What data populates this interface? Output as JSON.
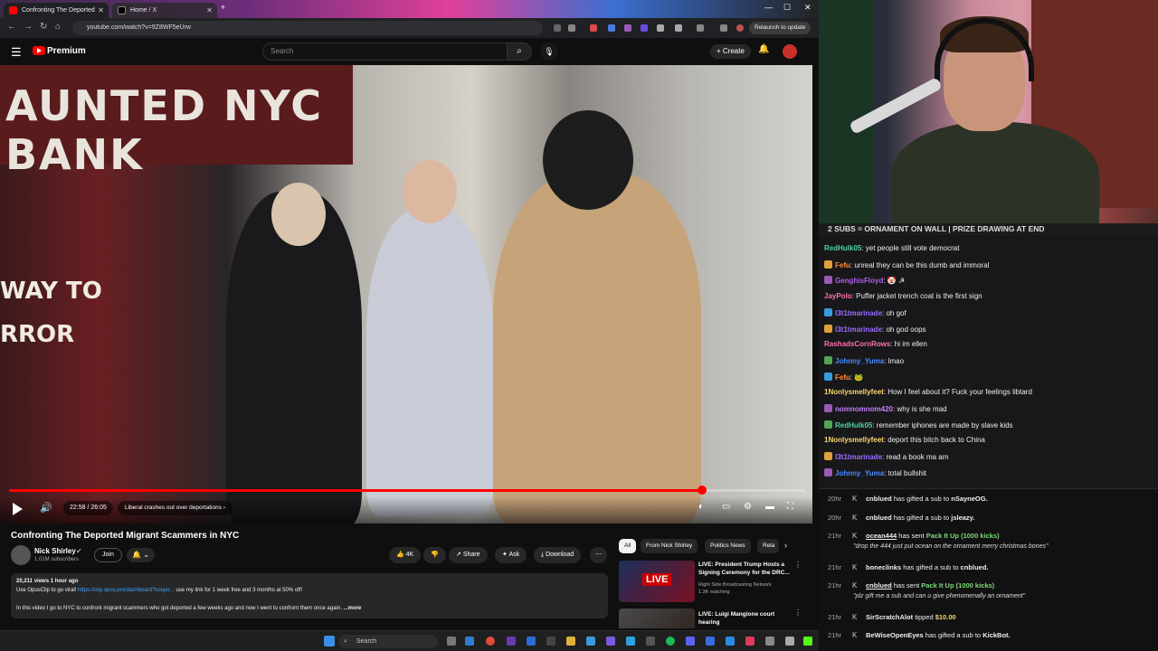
{
  "browser": {
    "tabs": [
      {
        "title": "Confronting The Deported",
        "active": true
      },
      {
        "title": "Home / X",
        "active": false
      }
    ],
    "url": "youtube.com/watch?v=9Z8WF5eUrw",
    "relaunch_label": "Relaunch to update"
  },
  "youtube": {
    "logo_label": "Premium",
    "search_placeholder": "Search",
    "create_label": "+ Create",
    "video": {
      "scene_text_line1": "AUNTED NYC BANK",
      "scene_text_line2": "WAY TO",
      "scene_text_line3": "RROR",
      "progress_fraction": 0.87,
      "time": "22:58 / 26:05",
      "chapter": "Liberal crashes out over deportations"
    },
    "title": "Confronting The Deported Migrant Scammers in NYC",
    "channel": {
      "name": "Nick Shirley",
      "subscribers": "1.01M subscribers",
      "join_label": "Join"
    },
    "actions": {
      "likes": "4K",
      "share": "Share",
      "ask": "Ask",
      "download": "Download"
    },
    "description": {
      "stats": "20,211 views  1 hour ago",
      "line1_prefix": "Use OpusClip to go viral! ",
      "line1_link": "https://clip.opus.pro/dashboard?coupo...",
      "line1_suffix": " use my link for 1 week free and 3 months at 50% off!",
      "line2": "In this video I go to NYC to confront migrant scammers who got deported a few weeks ago and now I went to confront them once again.",
      "more": "...more"
    },
    "chips": [
      "All",
      "From Nick Shirley",
      "Politics News",
      "Rela"
    ],
    "suggestions": [
      {
        "title": "LIVE: President Trump Hosts a Signing Ceremony for the DRC...",
        "channel": "Right Side Broadcasting Network",
        "meta": "1.3K watching",
        "badge": "LIVE"
      },
      {
        "title": "LIVE: Luigi Mangione court hearing",
        "channel": "",
        "meta": "",
        "badge": ""
      }
    ]
  },
  "taskbar": {
    "search_placeholder": "Search"
  },
  "stream": {
    "banner": "2 SUBS = ORNAMENT ON WALL | PRIZE DRAWING AT END",
    "chat": [
      {
        "user": "RedHulk05",
        "color": "#4fd1a5",
        "text": "yet people still vote democrat"
      },
      {
        "user": "Fefu",
        "color": "#ff8c3a",
        "text": "unreal they can be this dumb and immoral"
      },
      {
        "user": "GenghisFloyd",
        "color": "#b05fe8",
        "text": "🤡 ☭"
      },
      {
        "user": "JayPolo",
        "color": "#ff6fae",
        "text": "Puffer jacket trench coat is the first sign"
      },
      {
        "user": "l3t1tmarinade",
        "color": "#9b6bff",
        "text": "oh gof"
      },
      {
        "user": "l3t1tmarinade",
        "color": "#9b6bff",
        "text": "oh god oops"
      },
      {
        "user": "RashadsCornRows",
        "color": "#ff6fae",
        "text": "hi im ellen"
      },
      {
        "user": "Johnny_Yuma",
        "color": "#4a8cff",
        "text": "lmao"
      },
      {
        "user": "Fefu",
        "color": "#ff8c3a",
        "text": "🐸"
      },
      {
        "user": "1Nonlysmellyfeet",
        "color": "#f5d76e",
        "text": "How I feel about it? Fuck your feelings libtard"
      },
      {
        "user": "nomnomnom420",
        "color": "#c77dff",
        "text": "why is she mad"
      },
      {
        "user": "RedHulk05",
        "color": "#4fd1a5",
        "text": "remember iphones are made by slave kids"
      },
      {
        "user": "1Nonlysmellyfeet",
        "color": "#f5d76e",
        "text": "deport this bitch back to China"
      },
      {
        "user": "l3t1tmarinade",
        "color": "#9b6bff",
        "text": "read a book ma am"
      },
      {
        "user": "Johnny_Yuma",
        "color": "#4a8cff",
        "text": "total bullshit"
      }
    ],
    "events": [
      {
        "time": "20hr",
        "name": "cnblued",
        "text": "has gifted a sub to",
        "target": "nSayneOG."
      },
      {
        "time": "20hr",
        "name": "cnblued",
        "text": "has gifted a sub to",
        "target": "jsleazy."
      },
      {
        "time": "21hr",
        "name": "ocean444",
        "text": "has sent",
        "target": "Pack It Up (1000 kicks)",
        "sub": "\"drop the 444 just put ocean on the ornament merry christmas bones\""
      },
      {
        "time": "21hr",
        "name": "boneclinks",
        "text": "has gifted a sub to",
        "target": "cnblued."
      },
      {
        "time": "21hr",
        "name": "cnblued",
        "text": "has sent",
        "target": "Pack It Up (1000 kicks)",
        "sub": "\"plz gift me a sub and can u give phenomenally an ornament\""
      },
      {
        "time": "21hr",
        "name": "SirScratchAlot",
        "text": "tipped",
        "target": "$10.00"
      },
      {
        "time": "21hr",
        "name": "BeWiseOpenEyes",
        "text": "has gifted a sub to",
        "target": "KickBot."
      }
    ]
  },
  "colors": {
    "accent": "#ff0000",
    "chat_bg": "#18181b",
    "yt_bg": "#0f0f0f"
  }
}
